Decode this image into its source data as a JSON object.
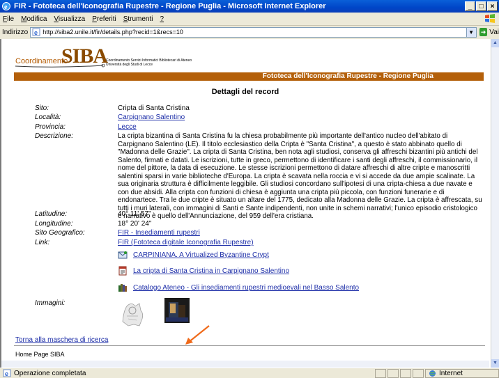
{
  "window": {
    "title": "FIR - Fototeca dell'Iconografia Rupestre - Regione Puglia - Microsoft Internet Explorer",
    "minimize": "_",
    "maximize": "□",
    "close": "×"
  },
  "menu": {
    "items": [
      {
        "key": "F",
        "rest": "ile"
      },
      {
        "key": "M",
        "rest": "odifica"
      },
      {
        "key": "V",
        "rest": "isualizza"
      },
      {
        "key": "P",
        "rest": "referiti"
      },
      {
        "key": "S",
        "rest": "trumenti"
      },
      {
        "key": "?",
        "rest": ""
      }
    ]
  },
  "address": {
    "label": "Indirizzo",
    "url": "http://siba2.unile.it/fir/details.php?recid=1&recs=10",
    "go_label": "Vai"
  },
  "header": {
    "logo_prefix": "Coordinamento",
    "logo_siba": "SIBA",
    "logo_sub1": "Coordinamento Servizi Informatici Bibliotecari di Ateneo",
    "logo_sub2": "Università degli Studi di Lecce",
    "banner": "Fototeca dell'Iconografia Rupestre - Regione Puglia"
  },
  "record": {
    "heading": "Dettagli del record",
    "sito_label": "Sito:",
    "sito_value": "Cripta di Santa Cristina",
    "localita_label": "Località:",
    "localita_value": "Carpignano Salentino",
    "provincia_label": "Provincia:",
    "provincia_value": "Lecce",
    "descrizione_label": "Descrizione:",
    "descrizione_value": "La cripta bizantina di Santa Cristina fu la chiesa probabilmente più importante dell'antico nucleo dell'abitato di Carpignano Salentino (LE). Il titolo ecclesiastico della Cripta è \"Santa Cristina\", a questo è stato abbinato quello di \"Madonna delle Grazie\". La cripta di Santa Cristina, ben nota agli studiosi, conserva gli affreschi bizantini più antichi del Salento, firmati e datati. Le iscrizioni, tutte in greco, permettono di identificare i santi degli affreschi, il commissionario, il nome del pittore, la data di esecuzione. Le stesse iscrizioni permettono di datare affreschi di altre cripte e manoscritti salentini sparsi in varie biblioteche d'Europa. La cripta è scavata nella roccia e vi si accede da due ampie scalinate. La sua originaria struttura è difficilmente leggibile. Gli studiosi concordano sull'ipotesi di una cripta-chiesa a due navate e con due absidi. Alla cripta con funzioni di chiesa è aggiunta una cripta più piccola, con funzioni funerarie e di endonartece. Tra le due cripte è situato un altare del 1775, dedicato alla Madonna delle Grazie. La cripta è affrescata, su tutti i muri laterali, con immagini di Santi e Sante indipendenti, non unite in schemi narrativi; l'unico episodio cristologico e narrativo è quello dell'Annunciazione, del 959 dell'era cristiana.",
    "latitudine_label": "Latitudine:",
    "latitudine_value": "40° 11' 57\"",
    "longitudine_label": "Longitudine:",
    "longitudine_value": "18° 20' 24\"",
    "geo_label": "Sito Geografico:",
    "geo_value": "FIR - Insediamenti rupestri",
    "link_label": "Link:",
    "link_value": "FIR (Fototeca digitale Iconografia Rupestre)",
    "extra_links": [
      "CARPINIANA. A Virtualized Byzantine Crypt",
      "La cripta di Santa Cristina in Carpignano Salentino",
      "Catalogo Ateneo - Gli insediamenti rupestri medioevali nel Basso Salento"
    ],
    "immagini_label": "Immagini:"
  },
  "footer": {
    "torna": "Torna alla maschera di ricerca",
    "home": "Home Page SIBA"
  },
  "status": {
    "text": "Operazione completata",
    "zone": "Internet"
  },
  "colors": {
    "banner": "#b4600a",
    "link": "#1d2ea8",
    "arrow": "#f06a1a"
  }
}
